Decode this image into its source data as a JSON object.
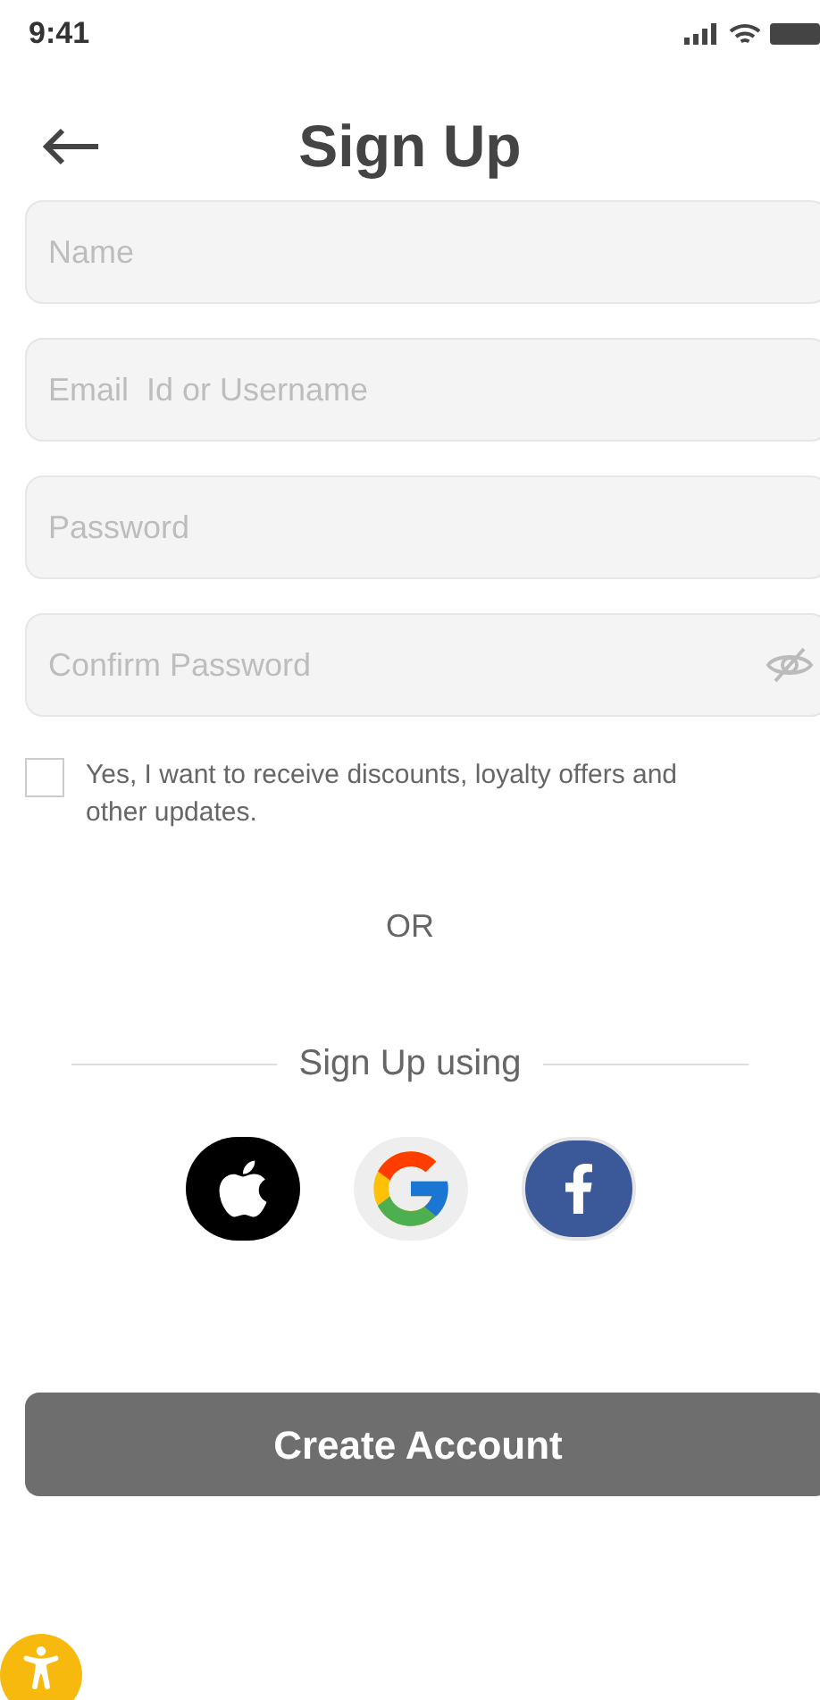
{
  "status_bar": {
    "time": "9:41"
  },
  "header": {
    "title": "Sign Up"
  },
  "fields": [
    {
      "placeholder": "Name",
      "kind": "text"
    },
    {
      "placeholder": "Email  Id or Username",
      "kind": "text"
    },
    {
      "placeholder": "Password",
      "kind": "text"
    },
    {
      "placeholder": "Confirm Password",
      "kind": "password"
    }
  ],
  "consent": {
    "label": "Yes, I want to receive discounts, loyalty offers and other updates.",
    "checked": false
  },
  "or_label": "OR",
  "social": {
    "label": "Sign Up using",
    "providers": [
      {
        "kind": "apple"
      },
      {
        "kind": "google"
      },
      {
        "kind": "facebook"
      }
    ]
  },
  "submit": {
    "label": "Create Account"
  }
}
